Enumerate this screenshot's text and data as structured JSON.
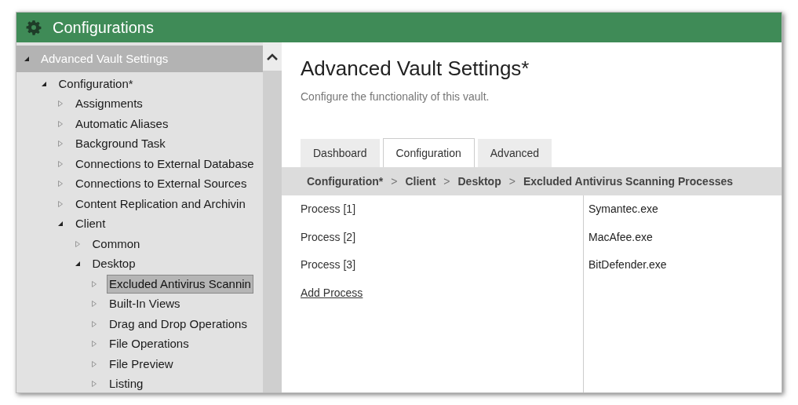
{
  "window": {
    "title": "Configurations"
  },
  "sidebar": {
    "root": {
      "label": "Advanced Vault Settings",
      "expanded": true,
      "selected": false
    },
    "tree": [
      {
        "label": "Configuration*",
        "expanded": true,
        "selected": false,
        "children": [
          {
            "label": "Assignments",
            "expanded": false,
            "selected": false
          },
          {
            "label": "Automatic Aliases",
            "expanded": false,
            "selected": false
          },
          {
            "label": "Background Task",
            "expanded": false,
            "selected": false
          },
          {
            "label": "Connections to External Database",
            "expanded": false,
            "selected": false
          },
          {
            "label": "Connections to External Sources",
            "expanded": false,
            "selected": false
          },
          {
            "label": "Content Replication and Archivin",
            "expanded": false,
            "selected": false
          },
          {
            "label": "Client",
            "expanded": true,
            "selected": false,
            "children": [
              {
                "label": "Common",
                "expanded": false,
                "selected": false
              },
              {
                "label": "Desktop",
                "expanded": true,
                "selected": false,
                "children": [
                  {
                    "label": "Excluded Antivirus Scannin",
                    "expanded": false,
                    "selected": true
                  },
                  {
                    "label": "Built-In Views",
                    "expanded": false,
                    "selected": false
                  },
                  {
                    "label": "Drag and Drop Operations",
                    "expanded": false,
                    "selected": false
                  },
                  {
                    "label": "File Operations",
                    "expanded": false,
                    "selected": false
                  },
                  {
                    "label": "File Preview",
                    "expanded": false,
                    "selected": false
                  },
                  {
                    "label": "Listing",
                    "expanded": false,
                    "selected": false
                  }
                ]
              }
            ]
          }
        ]
      }
    ]
  },
  "content": {
    "title": "Advanced Vault Settings*",
    "subtitle": "Configure the functionality of this vault.",
    "tabs": [
      {
        "label": "Dashboard",
        "selected": false
      },
      {
        "label": "Configuration",
        "selected": true
      },
      {
        "label": "Advanced",
        "selected": false
      }
    ],
    "breadcrumb": [
      {
        "label": "Configuration*"
      },
      {
        "label": ">"
      },
      {
        "label": "Client"
      },
      {
        "label": ">"
      },
      {
        "label": "Desktop"
      },
      {
        "label": ">"
      },
      {
        "label": "Excluded Antivirus Scanning Processes"
      }
    ],
    "rows": [
      {
        "name": "Process [1]",
        "value": "Symantec.exe"
      },
      {
        "name": "Process [2]",
        "value": "MacAfee.exe"
      },
      {
        "name": "Process [3]",
        "value": "BitDefender.exe"
      }
    ],
    "add_link": "Add Process"
  }
}
